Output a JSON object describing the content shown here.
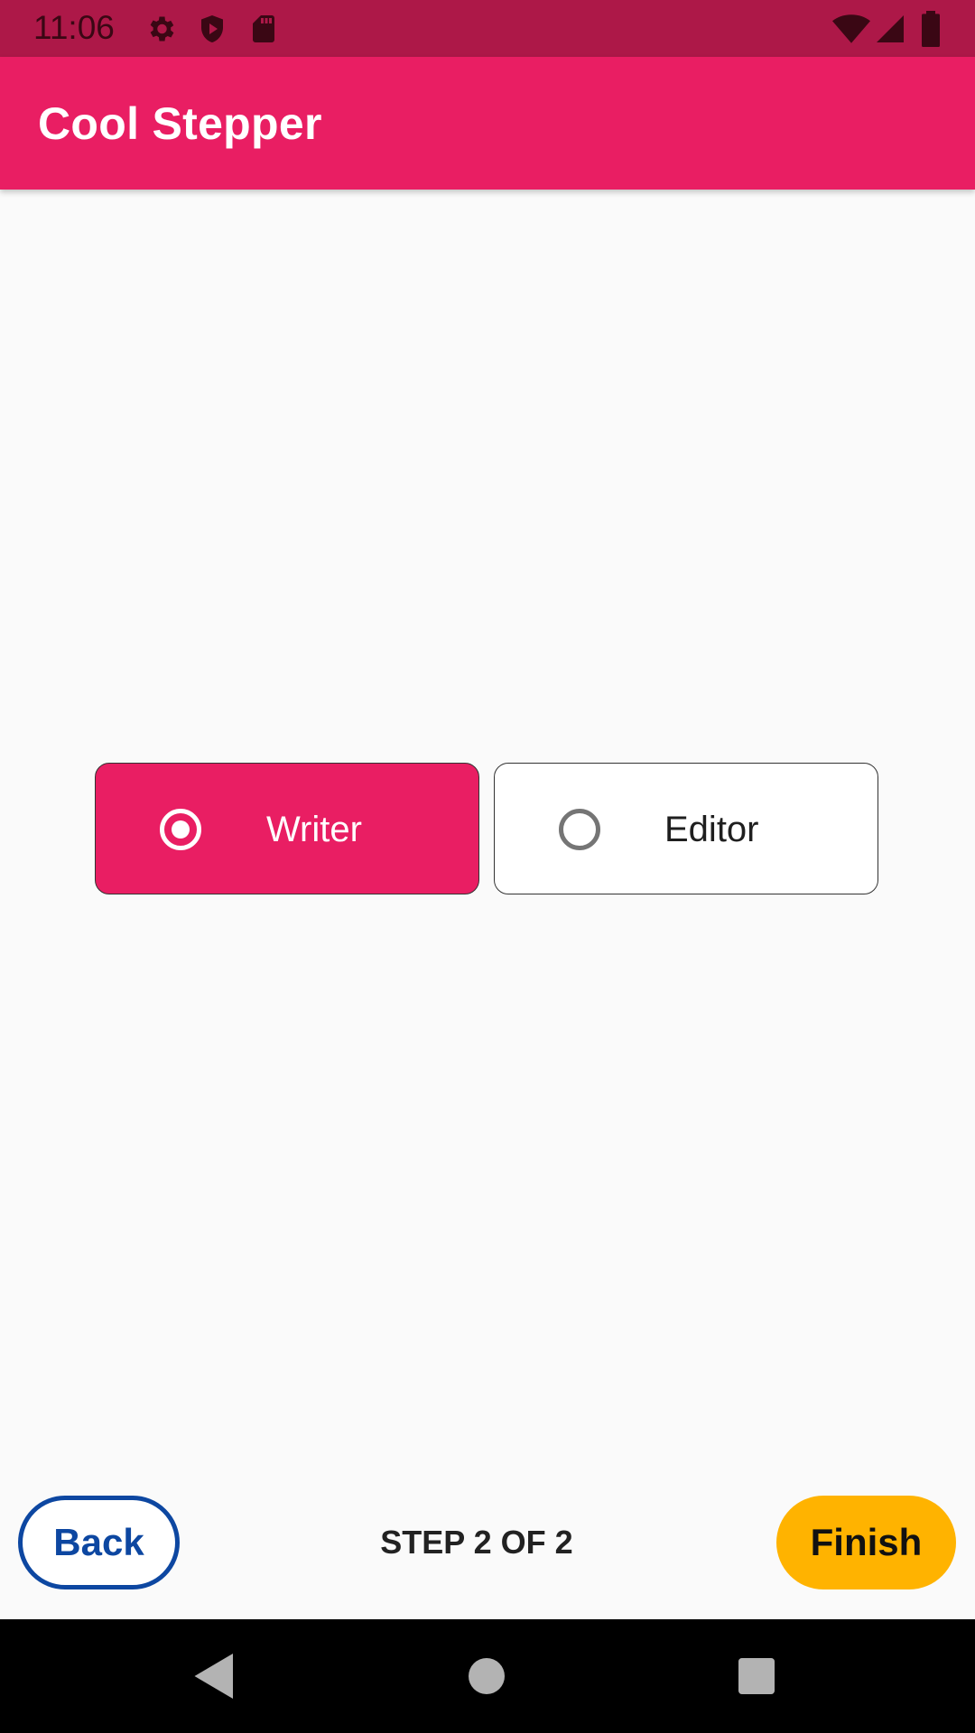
{
  "status_bar": {
    "time": "11:06",
    "icons": [
      "settings-icon",
      "shield-icon",
      "sd-card-icon",
      "wifi-icon",
      "signal-icon",
      "battery-icon"
    ]
  },
  "app_bar": {
    "title": "Cool Stepper"
  },
  "roles": {
    "options": [
      {
        "label": "Writer",
        "selected": true
      },
      {
        "label": "Editor",
        "selected": false
      }
    ]
  },
  "stepper": {
    "back_label": "Back",
    "step_text": "STEP 2 OF 2",
    "finish_label": "Finish"
  },
  "nav_bar": {
    "icons": [
      "back-nav-icon",
      "home-nav-icon",
      "recents-nav-icon"
    ]
  },
  "colors": {
    "primary": "#e91e63",
    "primary_dark": "#ad1848",
    "accent": "#ffb300",
    "back_button": "#0d47a1"
  }
}
